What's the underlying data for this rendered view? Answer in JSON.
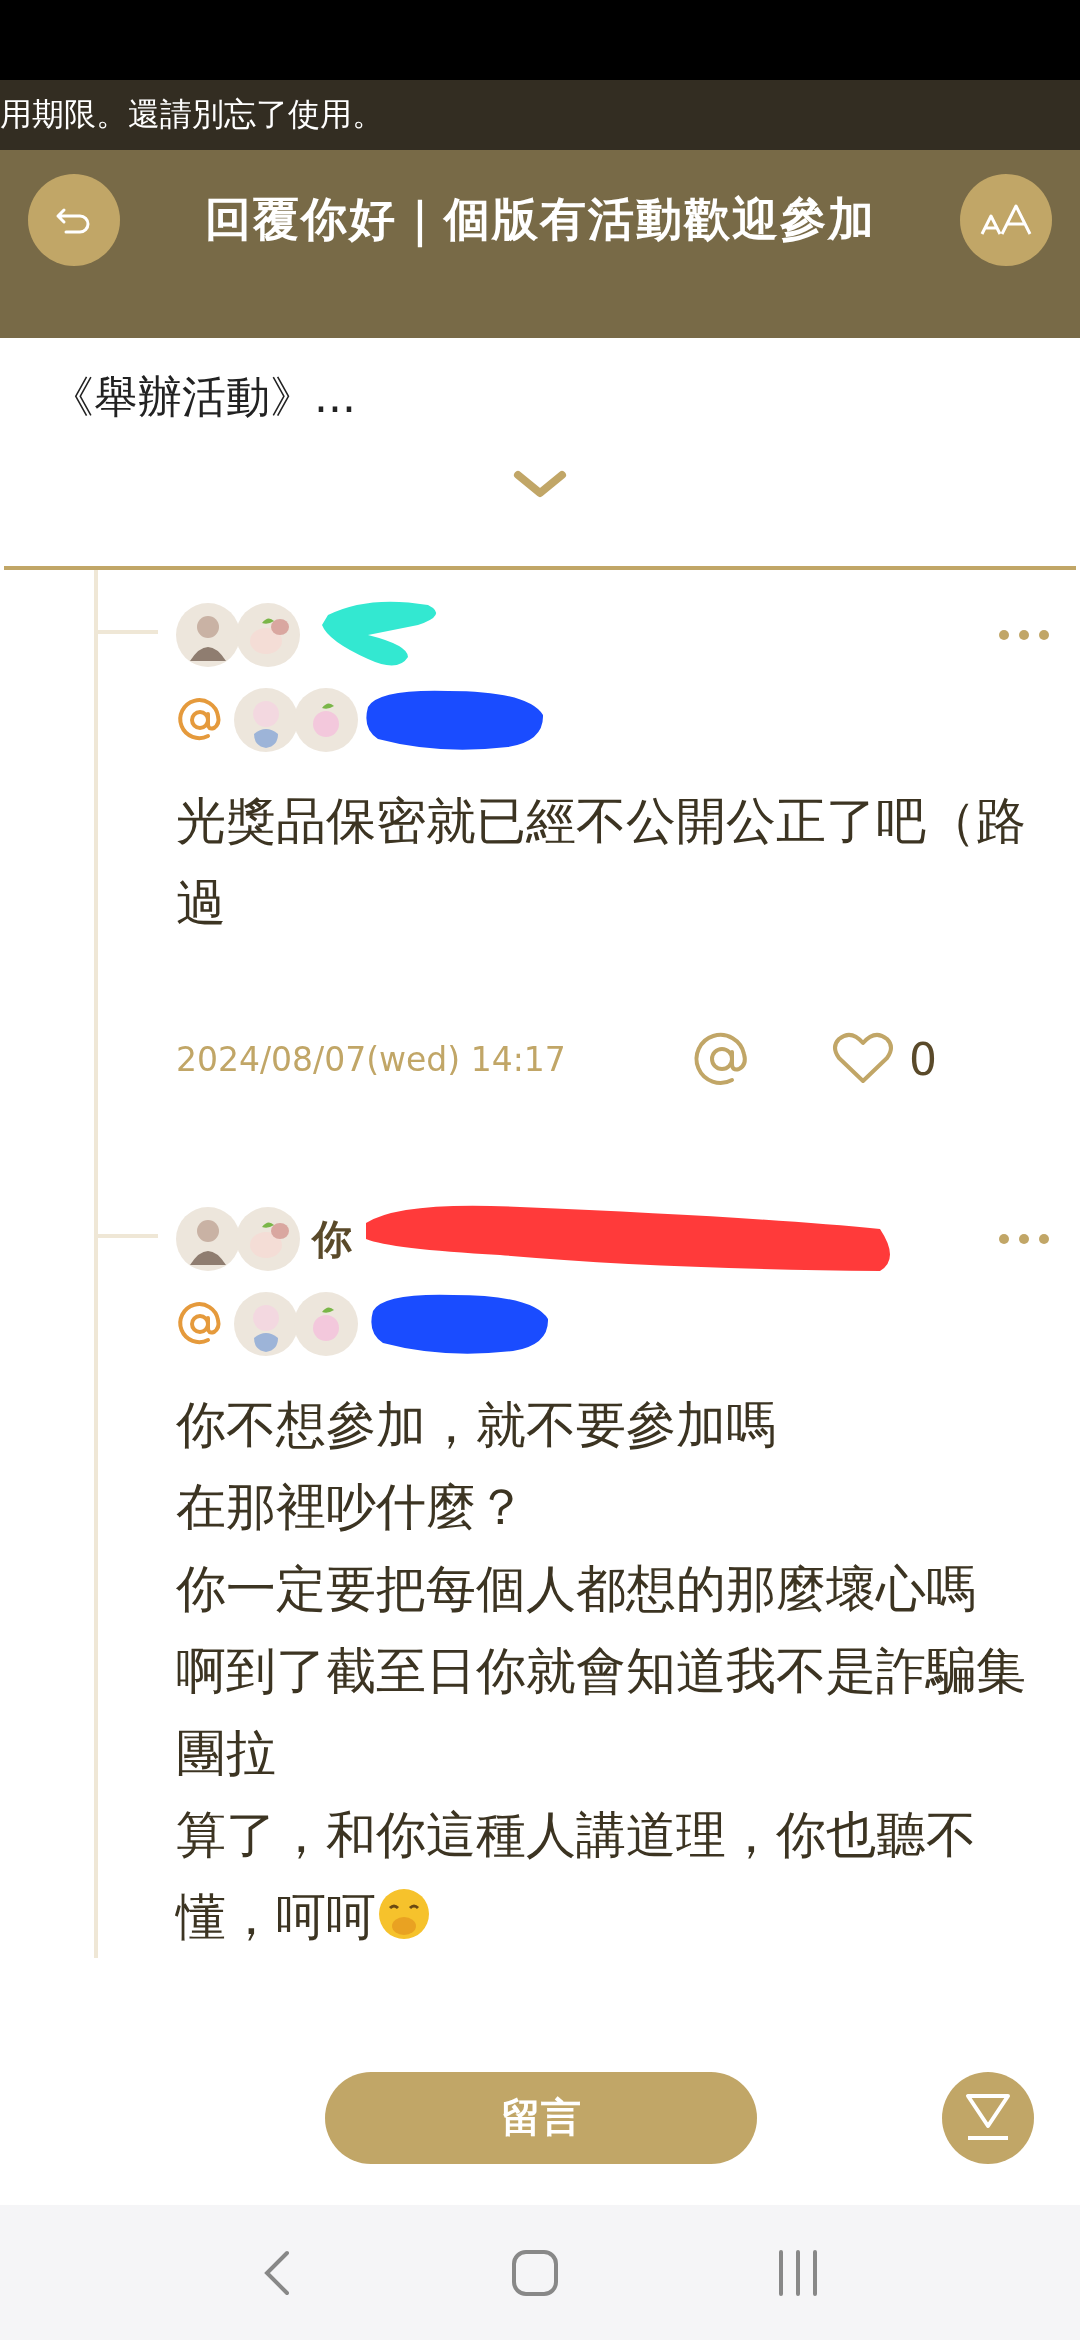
{
  "notice": {
    "text": "用期限。還請別忘了使用。"
  },
  "header": {
    "title": "回覆你好｜個版有活動歡迎參加"
  },
  "post": {
    "excerpt": "《舉辦活動》..."
  },
  "comments": [
    {
      "text_lines": [
        "光獎品保密就已經不公開公正了吧（路過"
      ],
      "timestamp": "2024/08/07(wed) 14:17",
      "likes": "0",
      "emoji": false
    },
    {
      "name": "你",
      "text_lines": [
        "你不想參加，就不要參加嗎",
        "在那裡吵什麼？",
        "你一定要把每個人都想的那麼壞心嗎",
        "啊到了截至日你就會知道我不是詐騙集團拉",
        "算了，和你這種人講道理，你也聽不懂，呵呵"
      ],
      "emoji": true
    }
  ],
  "footer": {
    "comment_button": "留言"
  }
}
